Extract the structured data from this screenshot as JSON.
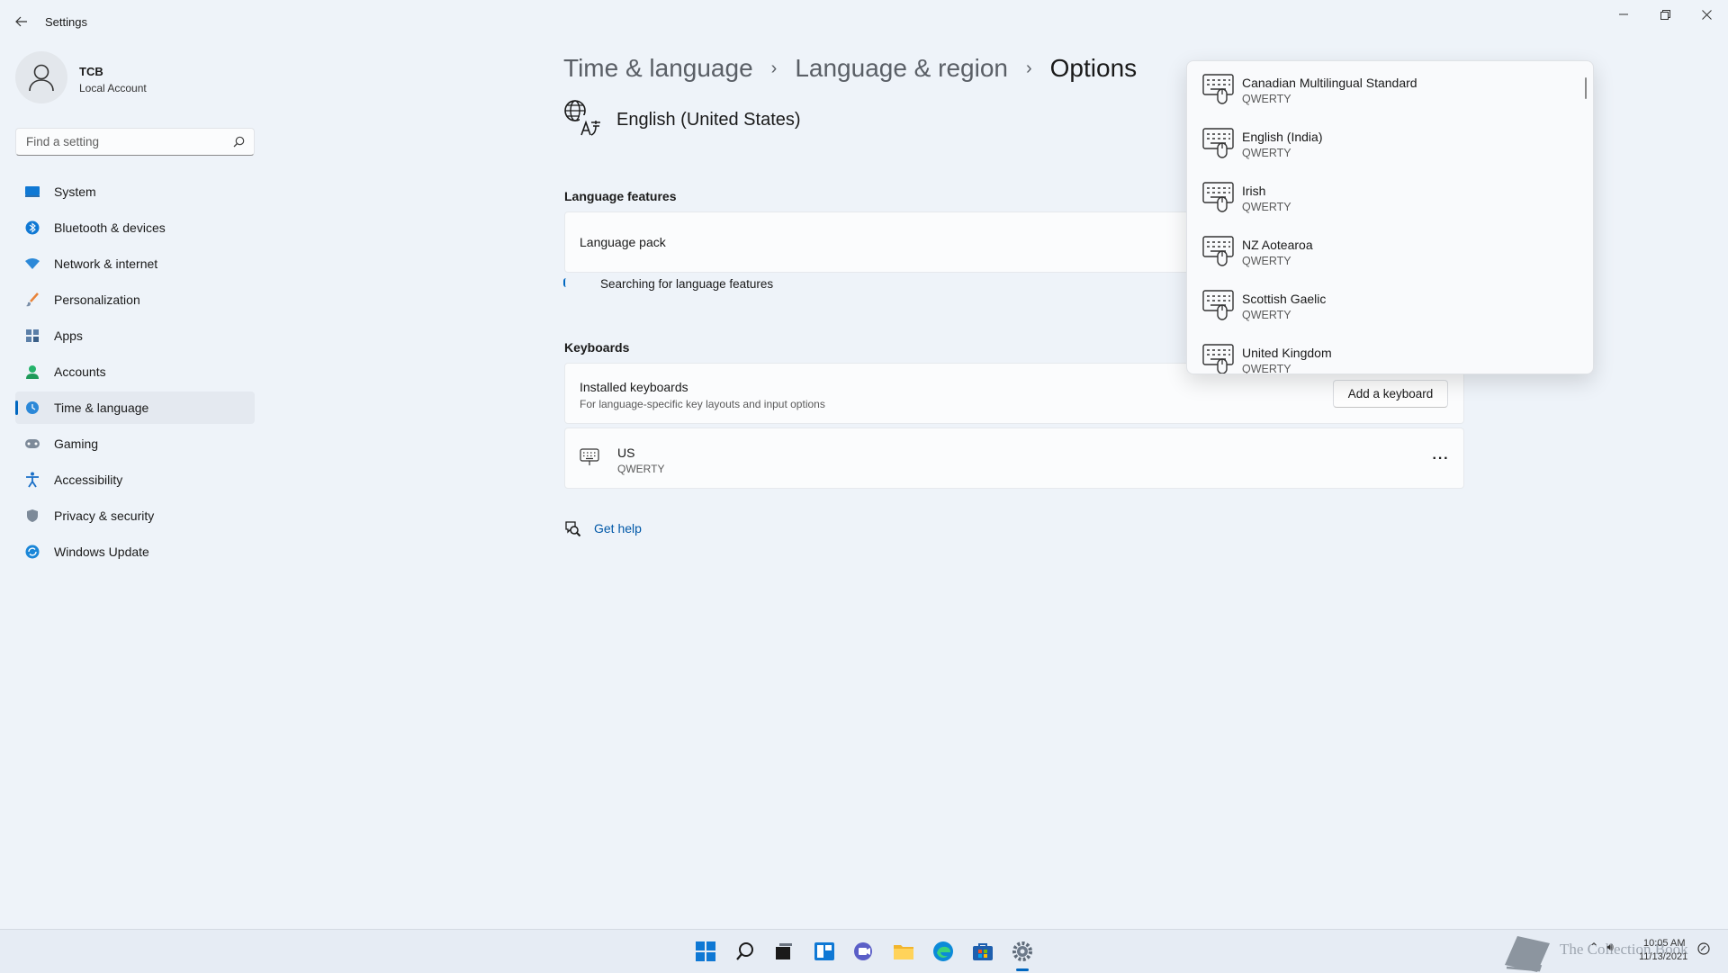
{
  "window": {
    "title": "Settings"
  },
  "profile": {
    "name": "TCB",
    "account_type": "Local Account"
  },
  "search": {
    "placeholder": "Find a setting"
  },
  "sidebar": {
    "items": [
      {
        "label": "System",
        "icon": "monitor-icon"
      },
      {
        "label": "Bluetooth & devices",
        "icon": "bluetooth-icon"
      },
      {
        "label": "Network & internet",
        "icon": "wifi-icon"
      },
      {
        "label": "Personalization",
        "icon": "brush-icon"
      },
      {
        "label": "Apps",
        "icon": "apps-icon"
      },
      {
        "label": "Accounts",
        "icon": "person-icon"
      },
      {
        "label": "Time & language",
        "icon": "globe-clock-icon",
        "selected": true
      },
      {
        "label": "Gaming",
        "icon": "controller-icon"
      },
      {
        "label": "Accessibility",
        "icon": "accessibility-icon"
      },
      {
        "label": "Privacy & security",
        "icon": "shield-icon"
      },
      {
        "label": "Windows Update",
        "icon": "update-icon"
      }
    ]
  },
  "breadcrumb": {
    "level1": "Time & language",
    "level2": "Language & region",
    "current": "Options",
    "separator": "›"
  },
  "language": {
    "title": "English (United States)"
  },
  "language_features": {
    "section_title": "Language features",
    "language_pack_label": "Language pack",
    "status_text": "Searching for language features"
  },
  "keyboards": {
    "section_title": "Keyboards",
    "installed_title": "Installed keyboards",
    "installed_subtitle": "For language-specific key layouts and input options",
    "add_button": "Add a keyboard",
    "items": [
      {
        "name": "US",
        "layout": "QWERTY"
      }
    ],
    "more_label": "···"
  },
  "help": {
    "label": "Get help"
  },
  "flyout": {
    "items": [
      {
        "name": "Canadian Multilingual Standard",
        "layout": "QWERTY"
      },
      {
        "name": "English (India)",
        "layout": "QWERTY"
      },
      {
        "name": "Irish",
        "layout": "QWERTY"
      },
      {
        "name": "NZ Aotearoa",
        "layout": "QWERTY"
      },
      {
        "name": "Scottish Gaelic",
        "layout": "QWERTY"
      },
      {
        "name": "United Kingdom",
        "layout": "QWERTY"
      }
    ]
  },
  "taskbar": {
    "icons": [
      "windows-start-icon",
      "search-icon",
      "task-view-icon",
      "widgets-icon",
      "chat-icon",
      "file-explorer-icon",
      "edge-icon",
      "store-icon",
      "settings-icon"
    ],
    "watermark": "The Collection Book",
    "time": "10:05 AM",
    "date": "11/13/2021"
  },
  "colors": {
    "accent": "#0067c0",
    "background": "#eef3f9",
    "card": "#fbfcfd"
  }
}
